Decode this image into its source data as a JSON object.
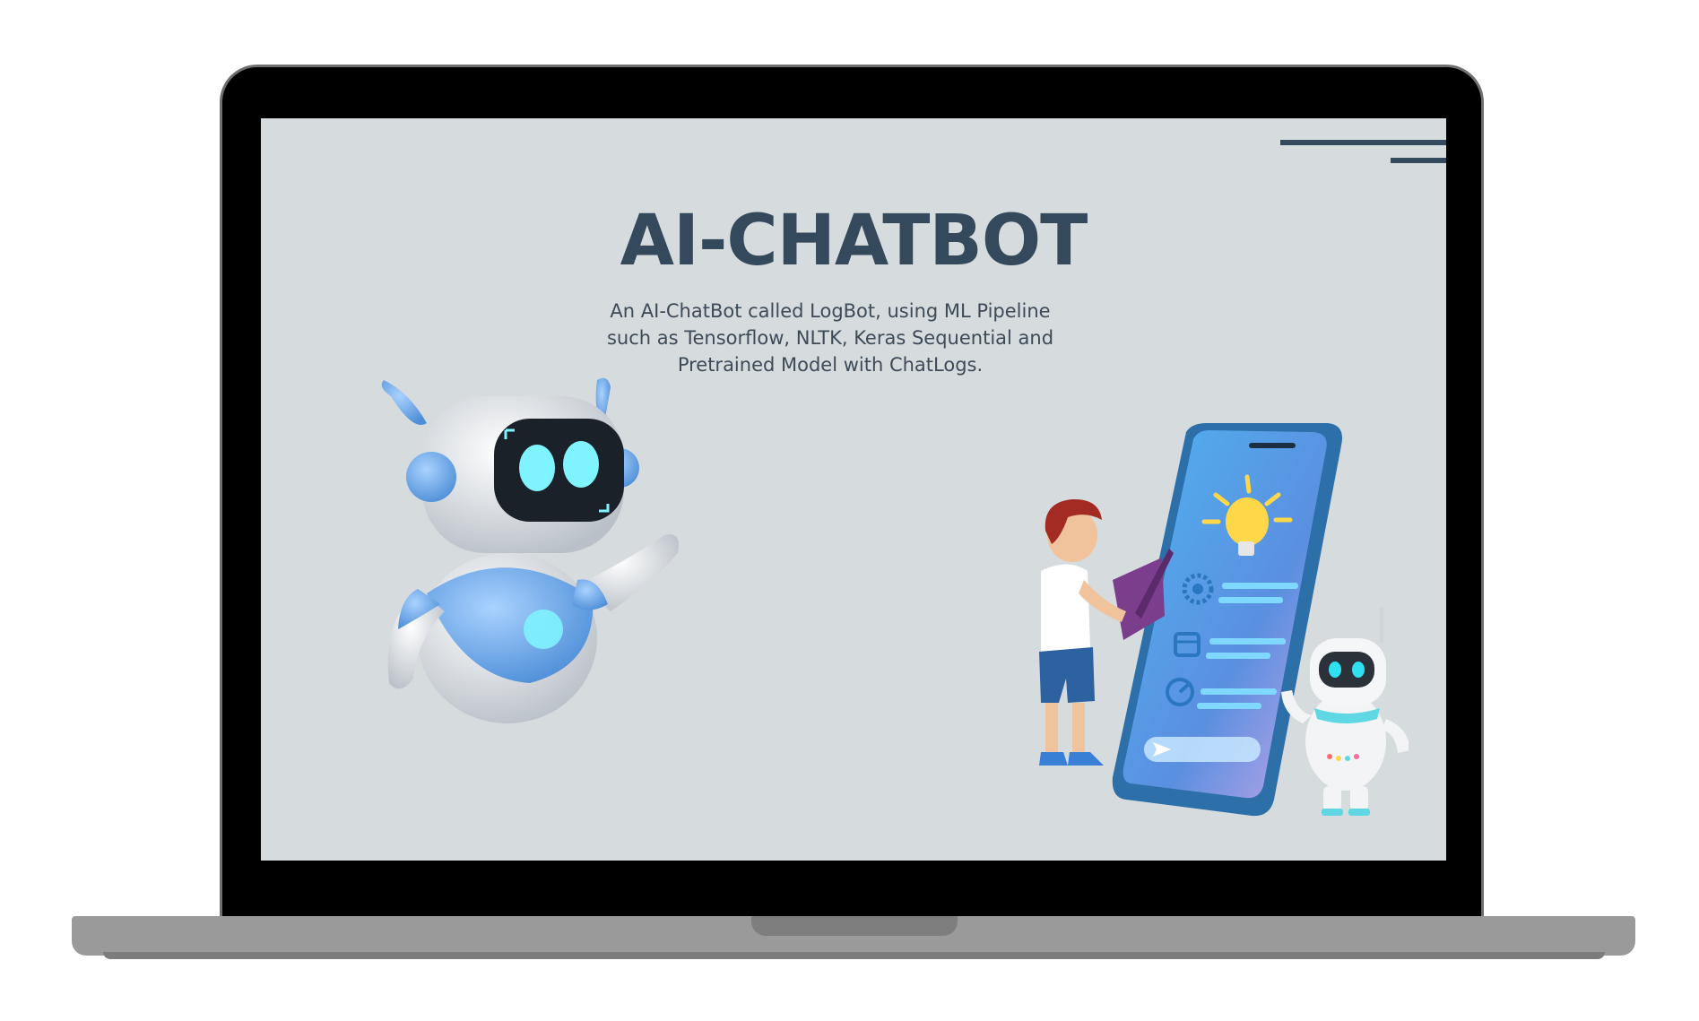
{
  "slide": {
    "title": "AI-CHATBOT",
    "subtitle_lines": [
      "An AI-ChatBot called LogBot, using ML Pipeline",
      "such as Tensorflow, NLTK, Keras Sequential  and",
      "Pretrained Model with ChatLogs."
    ]
  },
  "colors": {
    "screen_bg": "#d6dbde",
    "title": "#34495c",
    "accent_blue": "#6aa9e8",
    "eye_cyan": "#7ff3ff"
  },
  "icons": [
    "robot-illustration",
    "phone-illustration",
    "lightbulb-icon",
    "gear-icon",
    "calendar-icon",
    "send-icon"
  ]
}
